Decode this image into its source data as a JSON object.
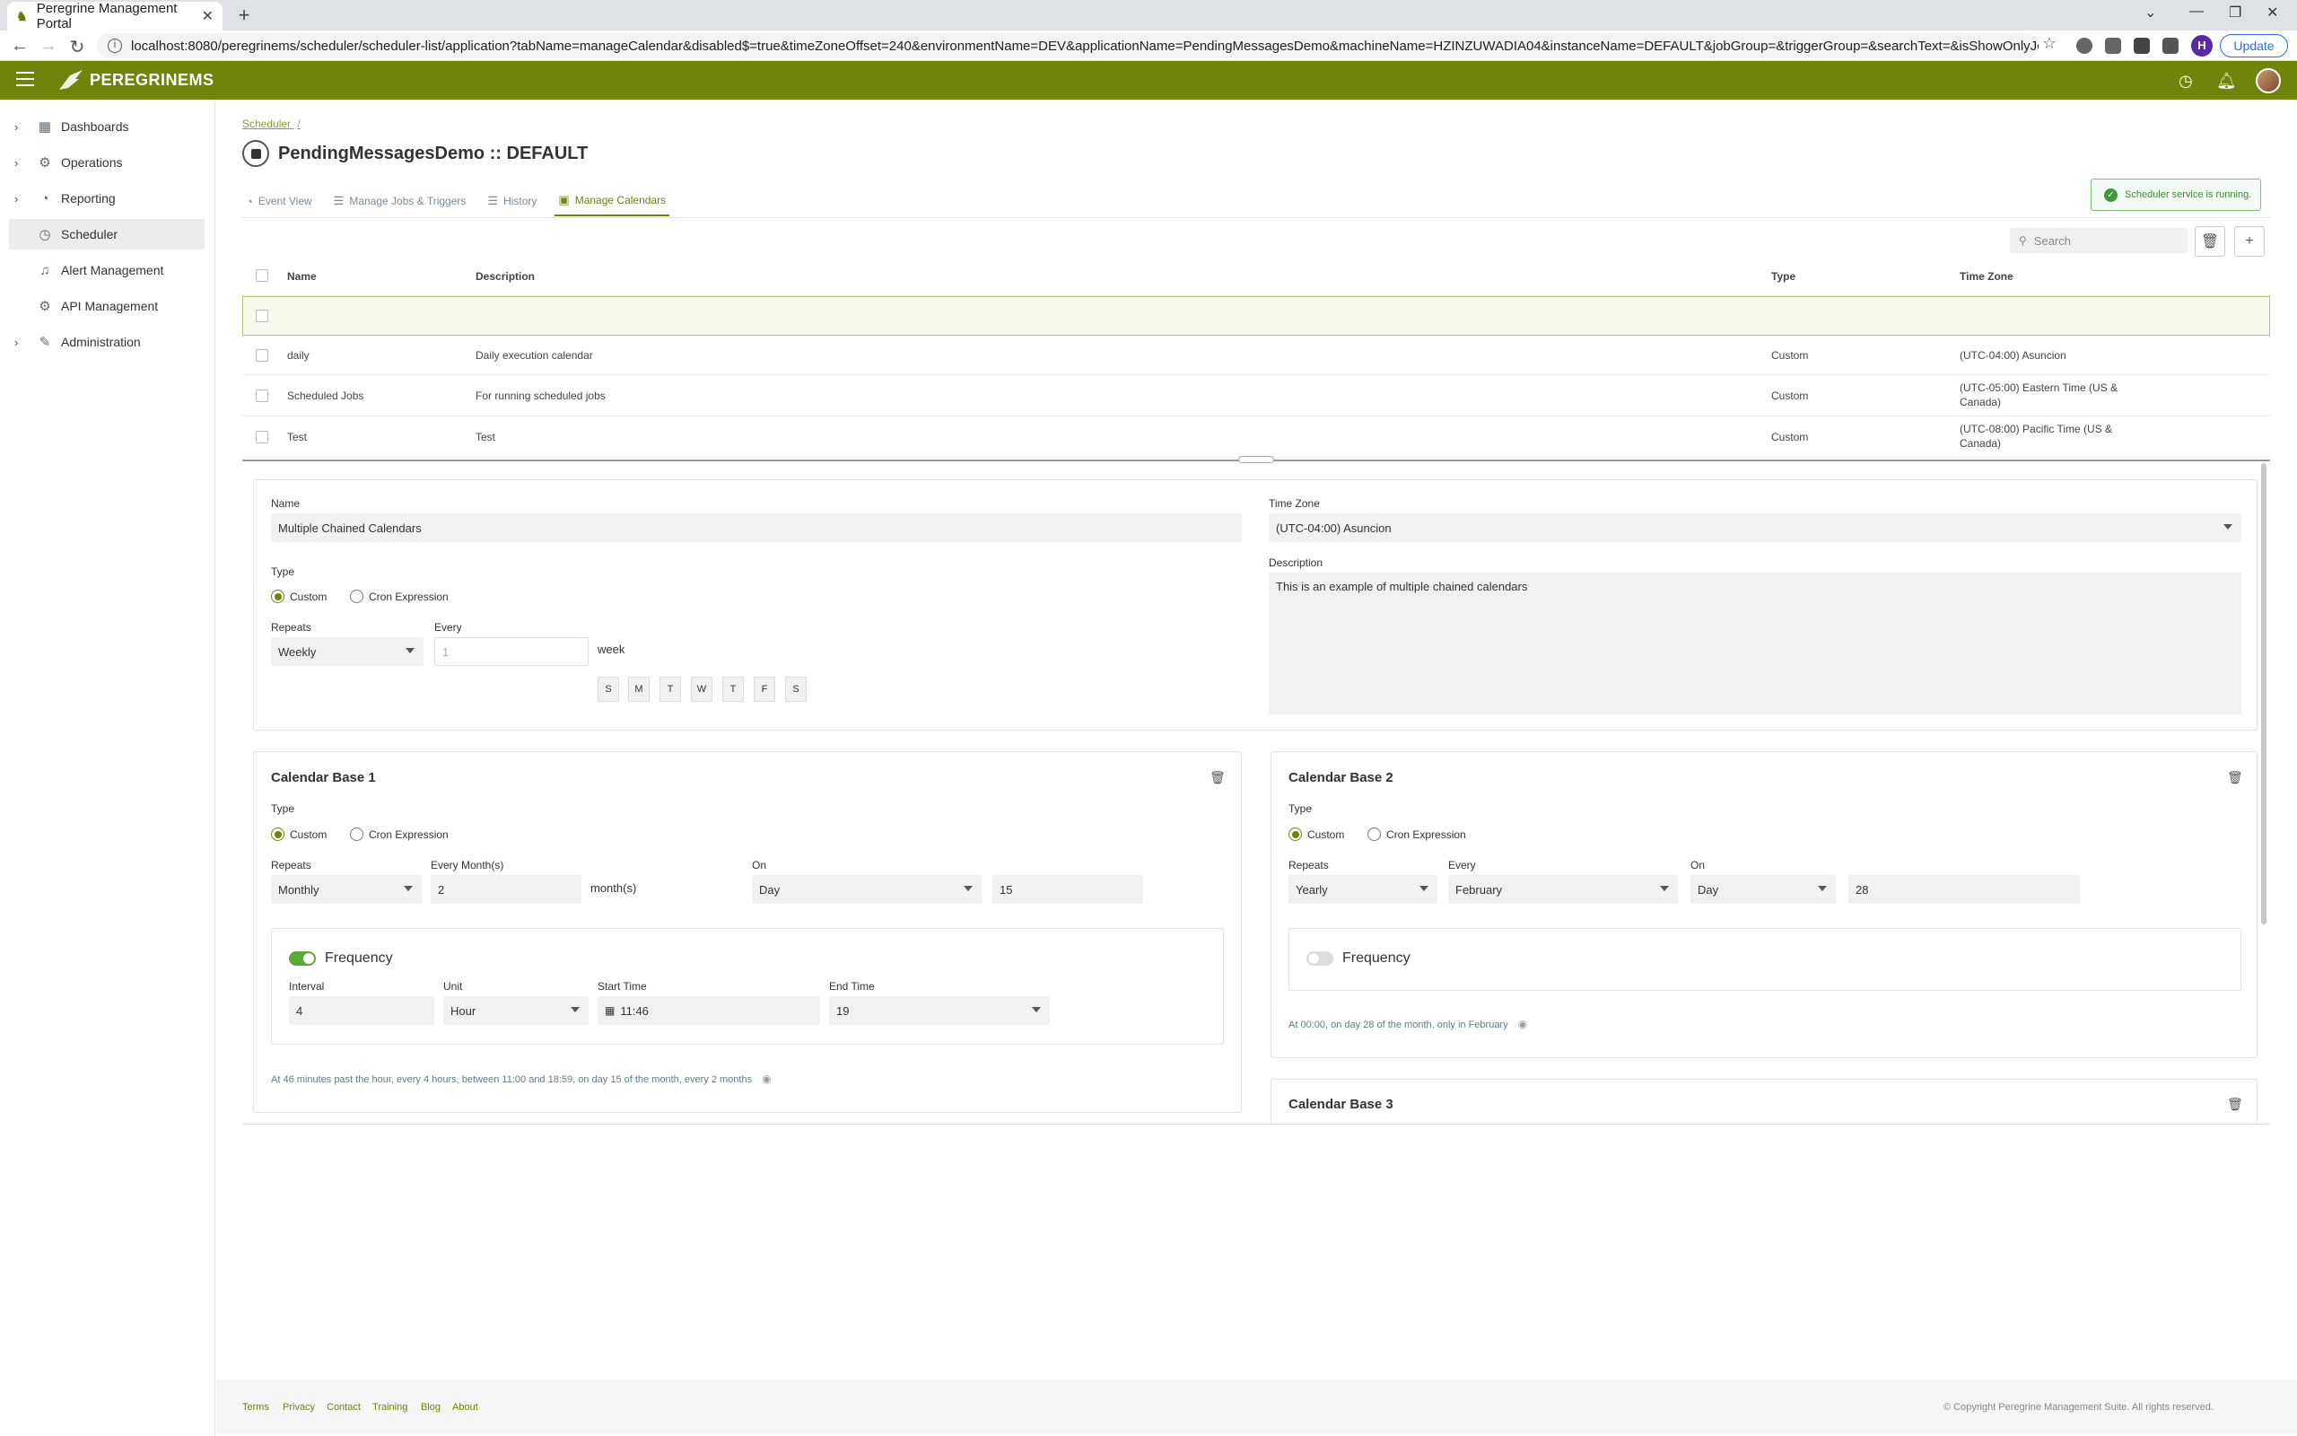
{
  "browser": {
    "tab_title": "Peregrine Management Portal",
    "url": "localhost:8080/peregrinems/scheduler/scheduler-list/application?tabName=manageCalendar&disabled$=true&timeZoneOffset=240&environmentName=DEV&applicationName=PendingMessagesDemo&machineName=HZINZUWADIA04&instanceName=DEFAULT&jobGroup=&triggerGroup=&searchText=&isShowOnlyJobs=&eventStartD...",
    "profile_initial": "H",
    "update_label": "Update"
  },
  "app": {
    "brand": "PEREGRINEMS",
    "accent": "#6e840b"
  },
  "sidebar": {
    "items": [
      {
        "label": "Dashboards",
        "icon": "dashboard-icon"
      },
      {
        "label": "Operations",
        "icon": "gear-icon"
      },
      {
        "label": "Reporting",
        "icon": "chart-icon"
      },
      {
        "label": "Scheduler",
        "icon": "clock-icon"
      },
      {
        "label": "Alert Management",
        "icon": "bell-icon"
      },
      {
        "label": "API Management",
        "icon": "gear-icon"
      },
      {
        "label": "Administration",
        "icon": "wrench-icon"
      }
    ]
  },
  "breadcrumb": {
    "item": "Scheduler",
    "sep": "/"
  },
  "page": {
    "title": "PendingMessagesDemo :: DEFAULT"
  },
  "tabs": [
    {
      "label": "Event View"
    },
    {
      "label": "Manage Jobs & Triggers"
    },
    {
      "label": "History"
    },
    {
      "label": "Manage Calendars"
    }
  ],
  "status": {
    "text": "Scheduler service is running."
  },
  "search": {
    "placeholder": "Search"
  },
  "table": {
    "headers": {
      "name": "Name",
      "description": "Description",
      "type": "Type",
      "timezone": "Time Zone"
    },
    "rows": [
      {
        "name": "daily",
        "description": "Daily execution calendar",
        "type": "Custom",
        "timezone": "(UTC-04:00) Asuncion"
      },
      {
        "name": "Scheduled Jobs",
        "description": "For running scheduled jobs",
        "type": "Custom",
        "timezone": "(UTC-05:00) Eastern Time (US & Canada)"
      },
      {
        "name": "Test",
        "description": "Test",
        "type": "Custom",
        "timezone": "(UTC-08:00) Pacific Time (US & Canada)"
      }
    ]
  },
  "form": {
    "name_label": "Name",
    "name_value": "Multiple Chained  Calendars",
    "timezone_label": "Time Zone",
    "timezone_value": "(UTC-04:00) Asuncion",
    "type_label": "Type",
    "custom_label": "Custom",
    "cron_label": "Cron Expression",
    "repeats_label": "Repeats",
    "repeats_value": "Weekly",
    "every_label": "Every",
    "every_placeholder": "1",
    "every_unit": "week",
    "days": [
      "S",
      "M",
      "T",
      "W",
      "T",
      "F",
      "S"
    ],
    "description_label": "Description",
    "description_value": "This is an example of multiple chained calendars"
  },
  "base1": {
    "title": "Calendar Base 1",
    "type_label": "Type",
    "custom_label": "Custom",
    "cron_label": "Cron Expression",
    "repeats_label": "Repeats",
    "repeats_value": "Monthly",
    "every_label": "Every Month(s)",
    "every_value": "2",
    "every_unit": "month(s)",
    "on_label": "On",
    "on_value": "Day",
    "on_day": "15",
    "frequency_label": "Frequency",
    "frequency_enabled": true,
    "interval_label": "Interval",
    "interval_value": "4",
    "unit_label": "Unit",
    "unit_value": "Hour",
    "start_label": "Start Time",
    "start_value": "11:46",
    "end_label": "End Time",
    "end_value": "19",
    "summary": "At 46 minutes past the hour, every 4 hours, between 11:00 and 18:59, on day 15 of the month, every 2 months"
  },
  "base2": {
    "title": "Calendar Base 2",
    "type_label": "Type",
    "custom_label": "Custom",
    "cron_label": "Cron Expression",
    "repeats_label": "Repeats",
    "repeats_value": "Yearly",
    "every_label": "Every",
    "every_value": "February",
    "on_label": "On",
    "on_value": "Day",
    "on_day": "28",
    "frequency_label": "Frequency",
    "frequency_enabled": false,
    "summary": "At 00:00, on day 28 of the month, only in February"
  },
  "base3": {
    "title": "Calendar Base 3"
  },
  "footer": {
    "links": [
      "Terms",
      "Privacy",
      "Contact",
      "Training",
      "Blog",
      "About"
    ],
    "copyright": "© Copyright Peregrine Management Suite. All rights reserved."
  }
}
